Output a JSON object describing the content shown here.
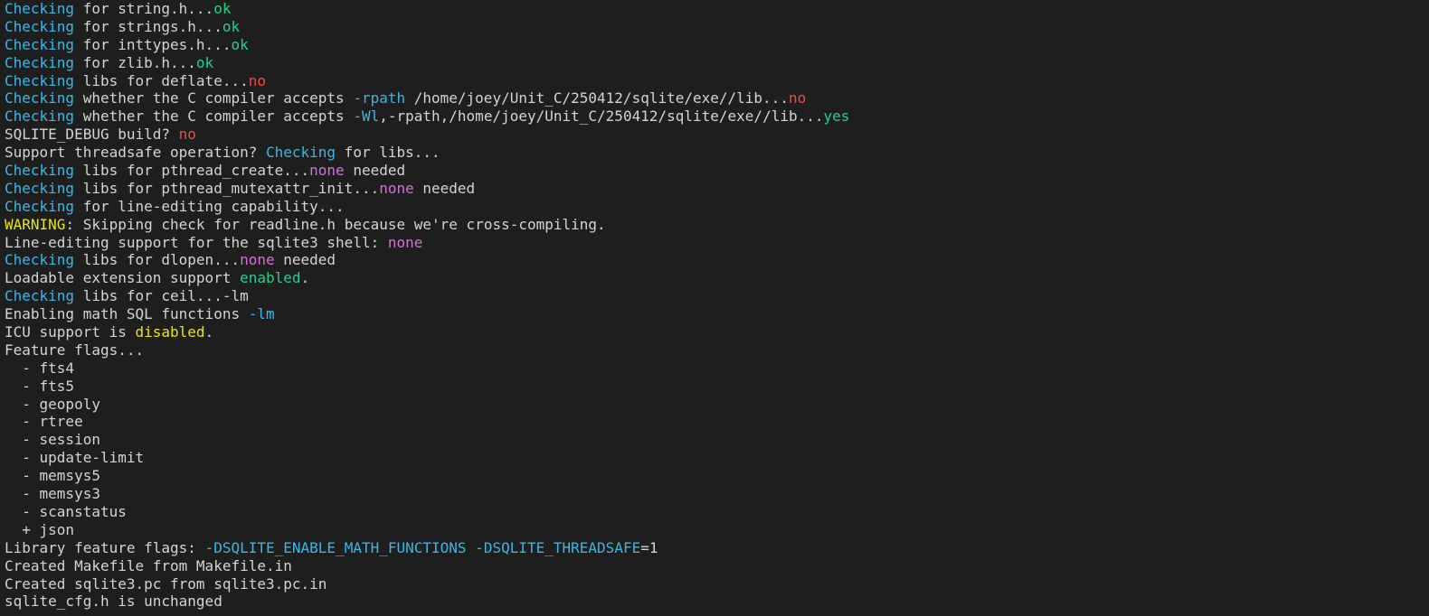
{
  "colors": {
    "background": "#1e1e1e",
    "default": "#d4d4d4",
    "blue": "#3ab7e6",
    "green": "#23d18b",
    "red": "#f14c4c",
    "magenta": "#d670d6",
    "yellow": "#e5e510"
  },
  "terminal": {
    "lines": [
      [
        {
          "t": "Checking",
          "c": "blue"
        },
        {
          "t": " for string.h..."
        },
        {
          "t": "ok",
          "c": "green"
        }
      ],
      [
        {
          "t": "Checking",
          "c": "blue"
        },
        {
          "t": " for strings.h..."
        },
        {
          "t": "ok",
          "c": "green"
        }
      ],
      [
        {
          "t": "Checking",
          "c": "blue"
        },
        {
          "t": " for inttypes.h..."
        },
        {
          "t": "ok",
          "c": "green"
        }
      ],
      [
        {
          "t": "Checking",
          "c": "blue"
        },
        {
          "t": " for zlib.h..."
        },
        {
          "t": "ok",
          "c": "green"
        }
      ],
      [
        {
          "t": "Checking",
          "c": "blue"
        },
        {
          "t": " libs for deflate..."
        },
        {
          "t": "no",
          "c": "red"
        }
      ],
      [
        {
          "t": "Checking",
          "c": "blue"
        },
        {
          "t": " whether the C compiler accepts "
        },
        {
          "t": "-rpath",
          "c": "blue"
        },
        {
          "t": " /home/joey/Unit_C/250412/sqlite/exe//lib..."
        },
        {
          "t": "no",
          "c": "red"
        }
      ],
      [
        {
          "t": "Checking",
          "c": "blue"
        },
        {
          "t": " whether the C compiler accepts "
        },
        {
          "t": "-Wl",
          "c": "blue"
        },
        {
          "t": ",-rpath,/home/joey/Unit_C/250412/sqlite/exe//lib..."
        },
        {
          "t": "yes",
          "c": "green"
        }
      ],
      [
        {
          "t": "SQLITE_DEBUG build? "
        },
        {
          "t": "no",
          "c": "red"
        }
      ],
      [
        {
          "t": "Support threadsafe operation? "
        },
        {
          "t": "Checking",
          "c": "blue"
        },
        {
          "t": " for libs..."
        }
      ],
      [
        {
          "t": "Checking",
          "c": "blue"
        },
        {
          "t": " libs for pthread_create..."
        },
        {
          "t": "none",
          "c": "magenta"
        },
        {
          "t": " needed"
        }
      ],
      [
        {
          "t": "Checking",
          "c": "blue"
        },
        {
          "t": " libs for pthread_mutexattr_init..."
        },
        {
          "t": "none",
          "c": "magenta"
        },
        {
          "t": " needed"
        }
      ],
      [
        {
          "t": "Checking",
          "c": "blue"
        },
        {
          "t": " for line-editing capability..."
        }
      ],
      [
        {
          "t": "WARNING",
          "c": "yellow"
        },
        {
          "t": ": Skipping check for readline.h because we're cross-compiling."
        }
      ],
      [
        {
          "t": "Line-editing support for the sqlite3 shell: "
        },
        {
          "t": "none",
          "c": "magenta"
        }
      ],
      [
        {
          "t": "Checking",
          "c": "blue"
        },
        {
          "t": " libs for dlopen..."
        },
        {
          "t": "none",
          "c": "magenta"
        },
        {
          "t": " needed"
        }
      ],
      [
        {
          "t": "Loadable extension support "
        },
        {
          "t": "enabled",
          "c": "green"
        },
        {
          "t": "."
        }
      ],
      [
        {
          "t": "Checking",
          "c": "blue"
        },
        {
          "t": " libs for ceil...-lm"
        }
      ],
      [
        {
          "t": "Enabling math SQL functions "
        },
        {
          "t": "-lm",
          "c": "blue"
        }
      ],
      [
        {
          "t": "ICU support is "
        },
        {
          "t": "disabled",
          "c": "yellow"
        },
        {
          "t": "."
        }
      ],
      [
        {
          "t": "Feature flags..."
        }
      ],
      [
        {
          "t": "  - fts4"
        }
      ],
      [
        {
          "t": "  - fts5"
        }
      ],
      [
        {
          "t": "  - geopoly"
        }
      ],
      [
        {
          "t": "  - rtree"
        }
      ],
      [
        {
          "t": "  - session"
        }
      ],
      [
        {
          "t": "  - update-limit"
        }
      ],
      [
        {
          "t": "  - memsys5"
        }
      ],
      [
        {
          "t": "  - memsys3"
        }
      ],
      [
        {
          "t": "  - scanstatus"
        }
      ],
      [
        {
          "t": "  + json"
        }
      ],
      [
        {
          "t": "Library feature flags: "
        },
        {
          "t": "-DSQLITE_ENABLE_MATH_FUNCTIONS",
          "c": "blue"
        },
        {
          "t": " "
        },
        {
          "t": "-DSQLITE_THREADSAFE",
          "c": "blue"
        },
        {
          "t": "=1"
        }
      ],
      [
        {
          "t": "Created Makefile from Makefile.in"
        }
      ],
      [
        {
          "t": "Created sqlite3.pc from sqlite3.pc.in"
        }
      ],
      [
        {
          "t": "sqlite_cfg.h is unchanged"
        }
      ]
    ]
  }
}
